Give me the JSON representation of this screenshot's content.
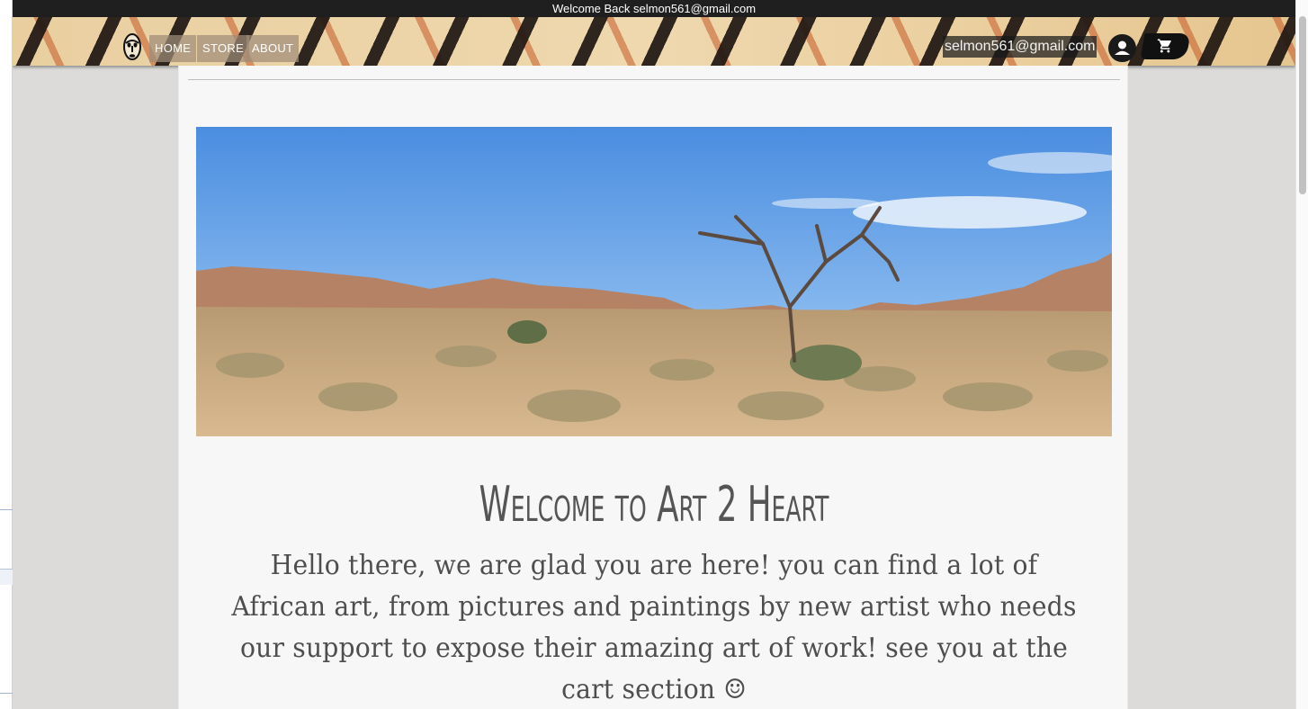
{
  "browser": {
    "left_strip": "browser-sidebar"
  },
  "header": {
    "welcome_text": "Welcome Back selmon561@gmail.com",
    "nav": [
      {
        "label": "HOME"
      },
      {
        "label": "STORE"
      },
      {
        "label": "ABOUT"
      }
    ],
    "user_email": "selmon561@gmail.com",
    "account_icon": "person-circle-icon",
    "cart_icon": "shopping-cart-icon",
    "logo_icon": "african-mask-icon"
  },
  "main": {
    "hero_image": "desert-landscape-with-dead-tree",
    "title": "Welcome to Art 2 Heart",
    "intro": "Hello there, we are glad you are here! you can find a lot of African art, from pictures and paintings by new artist who needs our support to expose their amazing art of work! see you at the cart section ☺"
  },
  "colors": {
    "topbar": "#1f1f1f",
    "page_bg": "#dcdbd9",
    "content_bg": "#f7f7f7",
    "text": "#555555",
    "nav_pattern_light": "#efd8ae",
    "nav_pattern_dark": "#1e1612",
    "nav_pattern_accent": "#c45826"
  }
}
